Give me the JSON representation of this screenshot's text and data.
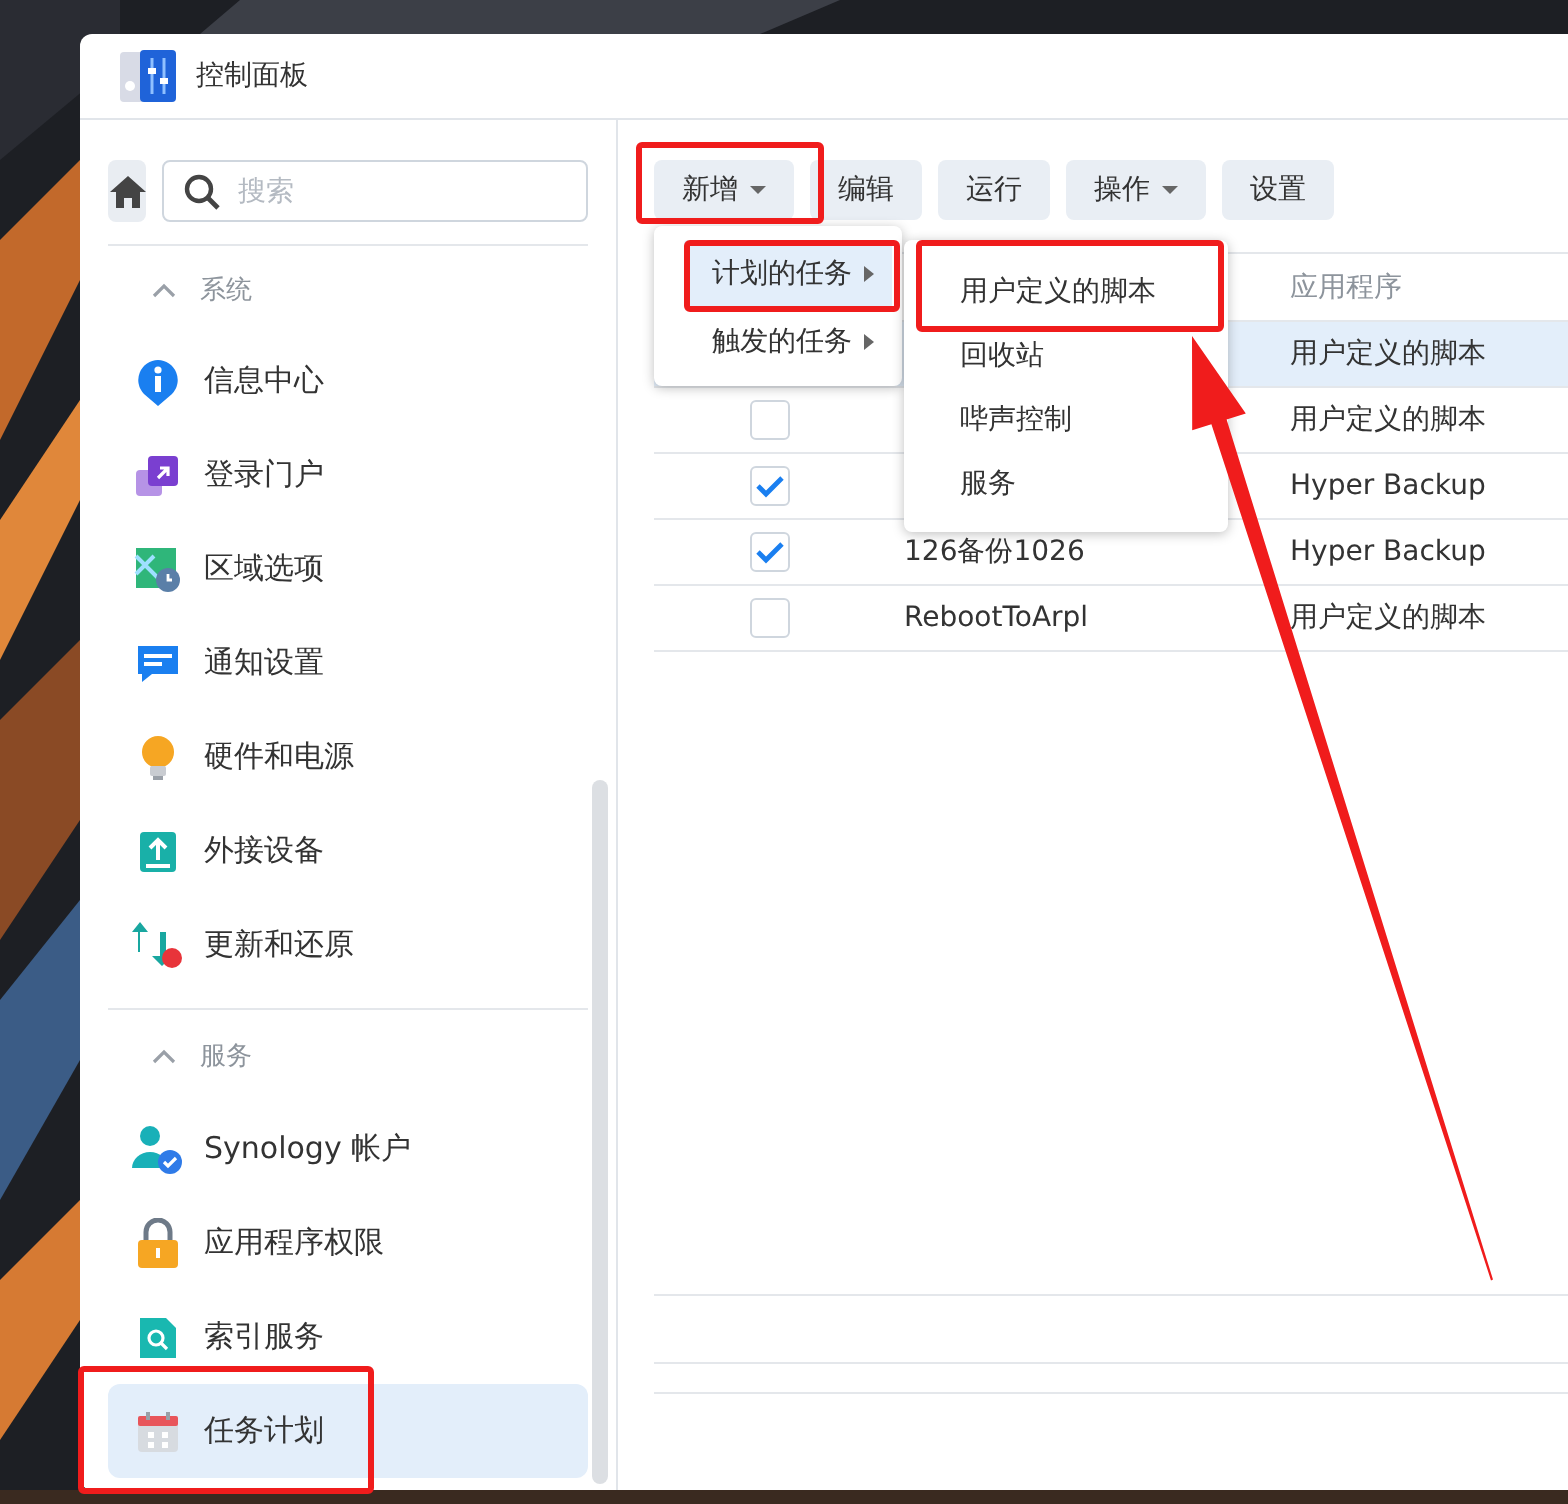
{
  "window": {
    "title": "控制面板"
  },
  "sidebar": {
    "search": {
      "placeholder": "搜索"
    },
    "sections": [
      {
        "title": "系统",
        "expanded": true,
        "items": [
          {
            "label": "信息中心",
            "selected": false
          },
          {
            "label": "登录门户",
            "selected": false
          },
          {
            "label": "区域选项",
            "selected": false
          },
          {
            "label": "通知设置",
            "selected": false
          },
          {
            "label": "硬件和电源",
            "selected": false
          },
          {
            "label": "外接设备",
            "selected": false
          },
          {
            "label": "更新和还原",
            "selected": false
          }
        ]
      },
      {
        "title": "服务",
        "expanded": true,
        "items": [
          {
            "label": "Synology 帐户",
            "selected": false
          },
          {
            "label": "应用程序权限",
            "selected": false
          },
          {
            "label": "索引服务",
            "selected": false
          },
          {
            "label": "任务计划",
            "selected": true
          }
        ]
      }
    ]
  },
  "toolbar": {
    "buttons": [
      {
        "label": "新增",
        "kind": "dropdown"
      },
      {
        "label": "编辑",
        "kind": "plain"
      },
      {
        "label": "运行",
        "kind": "plain"
      },
      {
        "label": "操作",
        "kind": "dropdown"
      },
      {
        "label": "设置",
        "kind": "plain"
      }
    ]
  },
  "table": {
    "application_header": "应用程序",
    "rows": [
      {
        "selected": true,
        "application": "用户定义的脚本"
      },
      {
        "selected": false,
        "enabled": false,
        "application": "用户定义的脚本"
      },
      {
        "selected": false,
        "enabled": true,
        "application": "Hyper Backup"
      },
      {
        "selected": false,
        "enabled": true,
        "name": "126备份1026",
        "application": "Hyper Backup"
      },
      {
        "selected": false,
        "enabled": false,
        "name": "RebootToArpl",
        "application": "用户定义的脚本"
      }
    ]
  },
  "menu": {
    "items": [
      {
        "label": "计划的任务",
        "selected": true
      },
      {
        "label": "触发的任务",
        "selected": false
      }
    ]
  },
  "submenu": {
    "items": [
      {
        "label": "用户定义的脚本"
      },
      {
        "label": "回收站"
      },
      {
        "label": "哔声控制"
      },
      {
        "label": "服务"
      }
    ]
  }
}
